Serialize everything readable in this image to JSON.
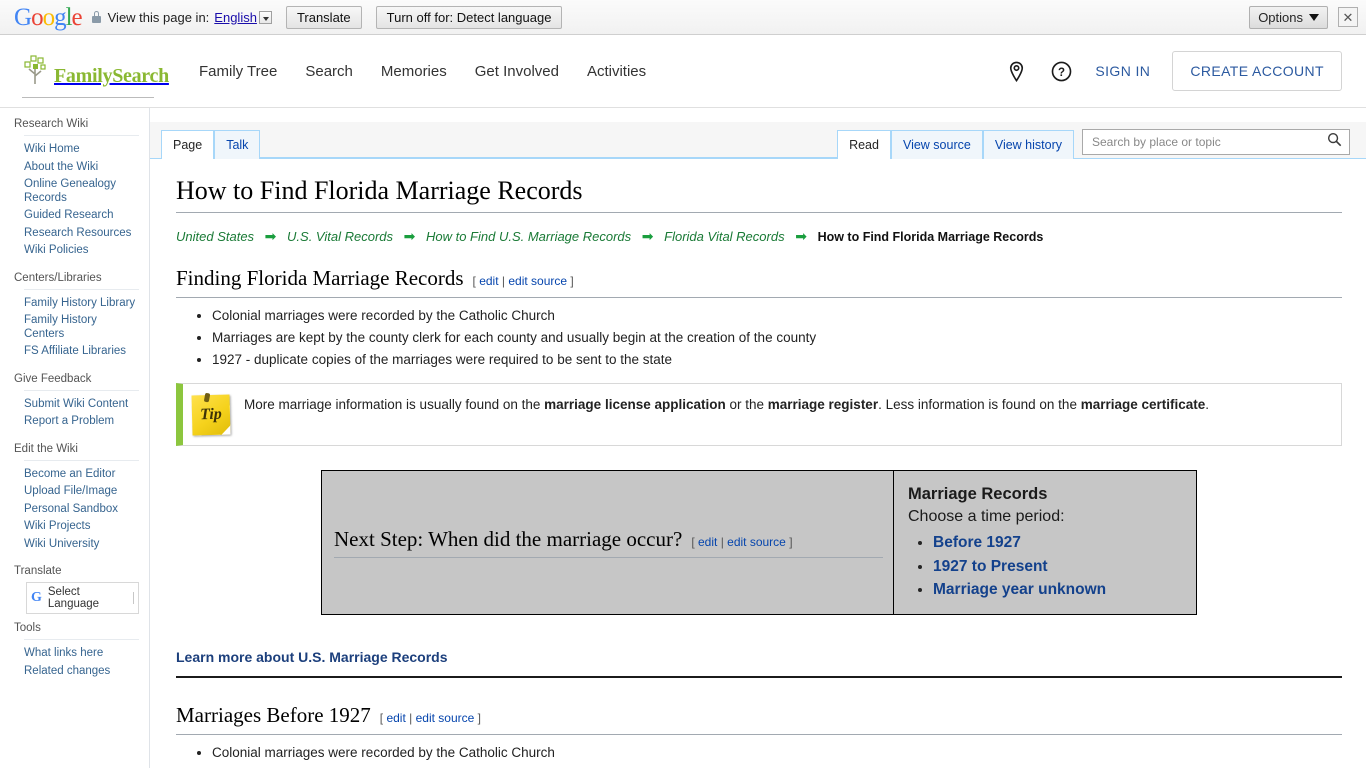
{
  "translate_bar": {
    "logo": "Google",
    "lock_icon": "lock-icon",
    "view_label": "View this page in:",
    "language": "English",
    "translate_button": "Translate",
    "turn_off_button": "Turn off for: Detect language",
    "options_button": "Options",
    "close_icon": "✕"
  },
  "header": {
    "brand": "FamilySearch",
    "nav": [
      {
        "label": "Family Tree"
      },
      {
        "label": "Search"
      },
      {
        "label": "Memories"
      },
      {
        "label": "Get Involved"
      },
      {
        "label": "Activities"
      }
    ],
    "location_icon": "location-pin-icon",
    "help_icon": "help-question-icon",
    "sign_in": "SIGN IN",
    "create_account": "CREATE ACCOUNT"
  },
  "sidebar": {
    "sections": [
      {
        "heading": "Research Wiki",
        "items": [
          "Wiki Home",
          "About the Wiki",
          "Online Genealogy Records",
          "Guided Research",
          "Research Resources",
          "Wiki Policies"
        ]
      },
      {
        "heading": "Centers/Libraries",
        "items": [
          "Family History Library",
          "Family History Centers",
          "FS Affiliate Libraries"
        ]
      },
      {
        "heading": "Give Feedback",
        "items": [
          "Submit Wiki Content",
          "Report a Problem"
        ]
      },
      {
        "heading": "Edit the Wiki",
        "items": [
          "Become an Editor",
          "Upload File/Image",
          "Personal Sandbox",
          "Wiki Projects",
          "Wiki University"
        ]
      }
    ],
    "translate_heading": "Translate",
    "select_language": "Select Language",
    "tools_heading": "Tools",
    "tools_items": [
      "What links here",
      "Related changes"
    ]
  },
  "tabs": {
    "left": [
      {
        "label": "Page",
        "active": true
      },
      {
        "label": "Talk",
        "active": false
      }
    ],
    "right": [
      {
        "label": "Read",
        "active": true
      },
      {
        "label": "View source",
        "active": false
      },
      {
        "label": "View history",
        "active": false
      }
    ],
    "search_placeholder": "Search by place or topic",
    "search_value": "",
    "search_icon": "magnifier-icon"
  },
  "article": {
    "title": "How to Find Florida Marriage Records",
    "breadcrumb": {
      "links": [
        "United States",
        "U.S. Vital Records",
        "How to Find U.S. Marriage Records",
        "Florida Vital Records"
      ],
      "arrow": "➡",
      "current": "How to Find Florida Marriage Records"
    },
    "section1": {
      "heading": "Finding Florida Marriage Records",
      "edit": "edit",
      "edit_source": "edit source",
      "bullets": [
        "Colonial marriages were recorded by the Catholic Church",
        "Marriages are kept by the county clerk for each county and usually begin at the creation of the county",
        "1927 - duplicate copies of the marriages were required to be sent to the state"
      ]
    },
    "tip": {
      "icon_label": "Tip",
      "part1": "More marriage information is usually found on the ",
      "bold1": "marriage license application",
      "part2": " or the ",
      "bold2": "marriage register",
      "part3": ". Less information is found on the ",
      "bold3": "marriage certificate",
      "part4": "."
    },
    "next_step": {
      "heading": "Next Step: When did the marriage occur?",
      "edit": "edit",
      "edit_source": "edit source",
      "panel_title": "Marriage Records",
      "panel_subtitle": "Choose a time period:",
      "options": [
        "Before 1927",
        "1927 to Present",
        "Marriage year unknown"
      ]
    },
    "learn_more": "Learn more about U.S. Marriage Records",
    "section2": {
      "heading": "Marriages Before 1927",
      "edit": "edit",
      "edit_source": "edit source",
      "bullets": [
        "Colonial marriages were recorded by the Catholic Church"
      ]
    }
  },
  "colors": {
    "brand_green": "#8ab832",
    "link_blue": "#36648f",
    "wiki_link": "#0645ad",
    "breadcrumb_green": "#1a7a36",
    "tip_accent": "#8cc63e",
    "panel_gray": "#c6c6c6"
  }
}
